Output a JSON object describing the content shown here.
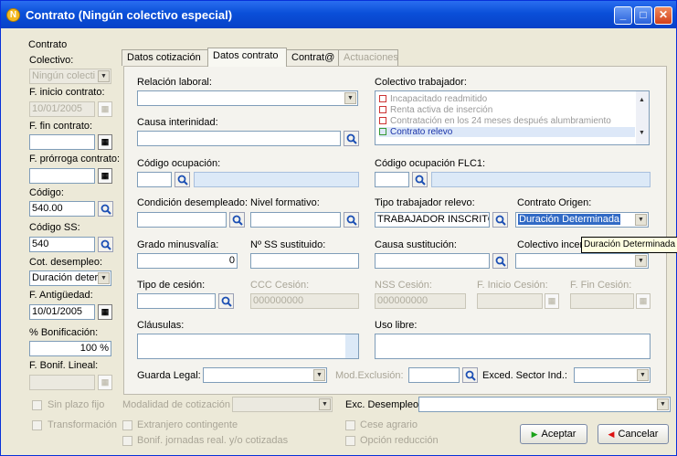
{
  "window": {
    "title": "Contrato  (Ningún colectivo especial)",
    "icon": "N"
  },
  "left": {
    "group_label": "Contrato",
    "colectivo_label": "Colectivo:",
    "colectivo_value": "Ningún colecti",
    "f_inicio_label": "F. inicio contrato:",
    "f_inicio_value": "10/01/2005",
    "f_fin_label": "F. fin contrato:",
    "f_prorroga_label": "F. prórroga contrato:",
    "codigo_label": "Código:",
    "codigo_value": "540.00",
    "codigo_ss_label": "Código SS:",
    "codigo_ss_value": "540",
    "cot_desempleo_label": "Cot. desempleo:",
    "cot_desempleo_value": "Duración deter",
    "f_antiguedad_label": "F. Antigüedad:",
    "f_antiguedad_value": "10/01/2005",
    "bonificacion_label": "% Bonificación:",
    "bonificacion_value": "100 %",
    "f_bonif_label": "F. Bonif. Lineal:"
  },
  "tabs": [
    "Datos cotización",
    "Datos contrato",
    "Contrat@",
    "Actuaciones"
  ],
  "form": {
    "relacion_laboral": "Relación laboral:",
    "causa_interinidad": "Causa interinidad:",
    "codigo_ocupacion": "Código ocupación:",
    "colectivo_trabajador": "Colectivo trabajador:",
    "colectivo_items": [
      {
        "label": "Incapacitado readmitido",
        "checked": false
      },
      {
        "label": "Renta activa de inserción",
        "checked": false
      },
      {
        "label": "Contratación en los 24 meses después alumbramiento",
        "checked": false
      },
      {
        "label": "Contrato relevo",
        "checked": true
      }
    ],
    "codigo_ocupacion_flc": "Código ocupación FLC1:",
    "condicion_desempleado": "Condición desempleado:",
    "nivel_formativo": "Nivel formativo:",
    "tipo_trabajador_relevo": "Tipo trabajador relevo:",
    "tipo_trabajador_relevo_value": "TRABAJADOR INSCRITO",
    "contrato_origen": "Contrato Origen:",
    "contrato_origen_value": "Duración Determinada",
    "grado_minusvalia": "Grado minusvalía:",
    "grado_minusvalia_value": "0",
    "nss_sustituido": "Nº SS sustituido:",
    "causa_sustitucion": "Causa sustitución:",
    "colectivo_incent": "Colectivo incen",
    "tooltip": "Duración Determinada",
    "tipo_cesion": "Tipo de cesión:",
    "ccc_cesion": "CCC Cesión:",
    "ccc_cesion_value": "000000000",
    "nss_cesion": "NSS Cesión:",
    "nss_cesion_value": "000000000",
    "f_inicio_cesion": "F. Inicio Cesión:",
    "f_fin_cesion": "F. Fin Cesión:",
    "clausulas": "Cláusulas:",
    "uso_libre": "Uso libre:",
    "guarda_legal": "Guarda Legal:",
    "mod_exclusion": "Mod.Exclusión:",
    "exced_sector": "Exced. Sector Ind.:"
  },
  "bottom": {
    "sin_plazo": "Sin plazo fijo",
    "transformacion": "Transformación",
    "modalidad_cotizacion": "Modalidad de cotización",
    "exc_desempleo": "Exc. Desempleo",
    "extranjero": "Extranjero contingente",
    "bonif_jornadas": "Bonif. jornadas real. y/o cotizadas",
    "cese_agrario": "Cese agrario",
    "opcion_reduccion": "Opción reducción",
    "aceptar": "Aceptar",
    "cancelar": "Cancelar"
  }
}
